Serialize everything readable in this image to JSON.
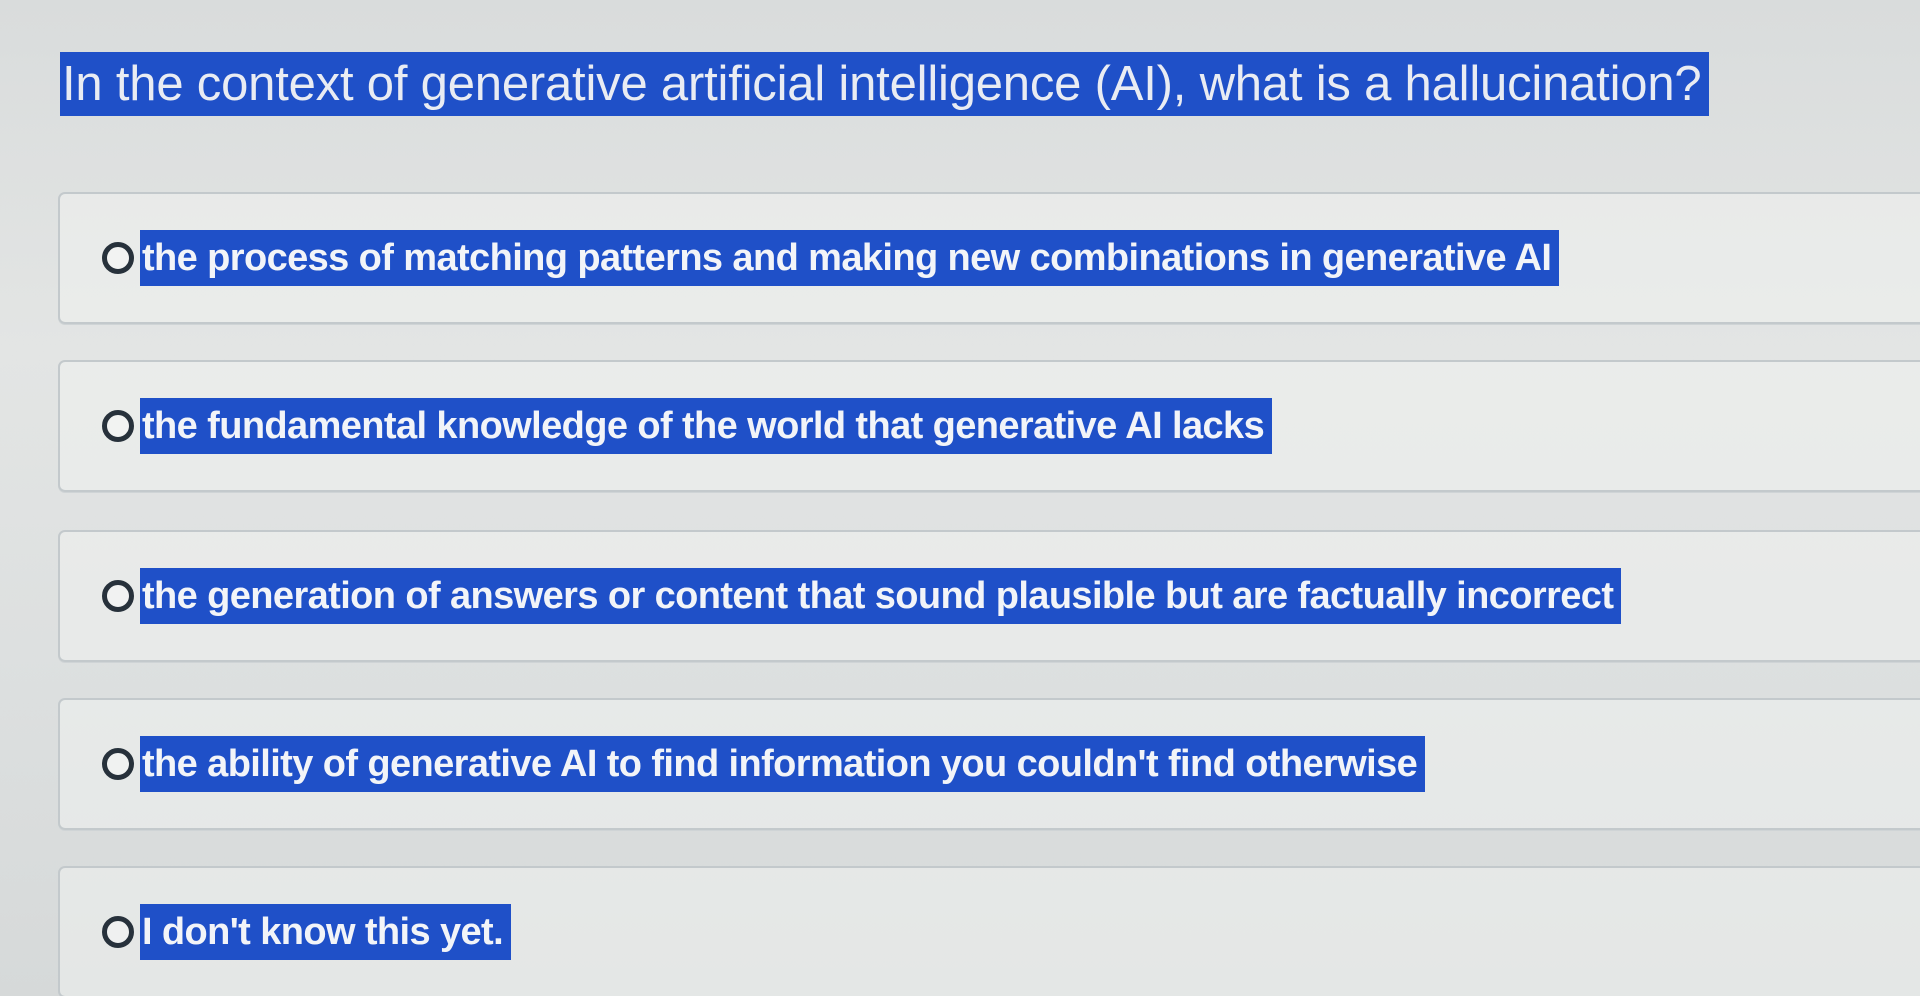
{
  "quiz": {
    "question": "In the context of generative artificial intelligence (AI), what is a hallucination?",
    "options": [
      {
        "label": "the process of matching patterns and making new combinations in generative AI"
      },
      {
        "label": "the fundamental knowledge of the world that generative AI lacks"
      },
      {
        "label": "the generation of answers or content that sound plausible but are factually incorrect"
      },
      {
        "label": "the ability of generative AI to find information you couldn't find otherwise"
      },
      {
        "label": "I don't know this yet."
      }
    ]
  },
  "colors": {
    "highlight": "#1f50c8",
    "background": "#dfe2e1",
    "radio_border": "#27313b"
  },
  "icons": {
    "radio": "radio-unselected-icon"
  }
}
